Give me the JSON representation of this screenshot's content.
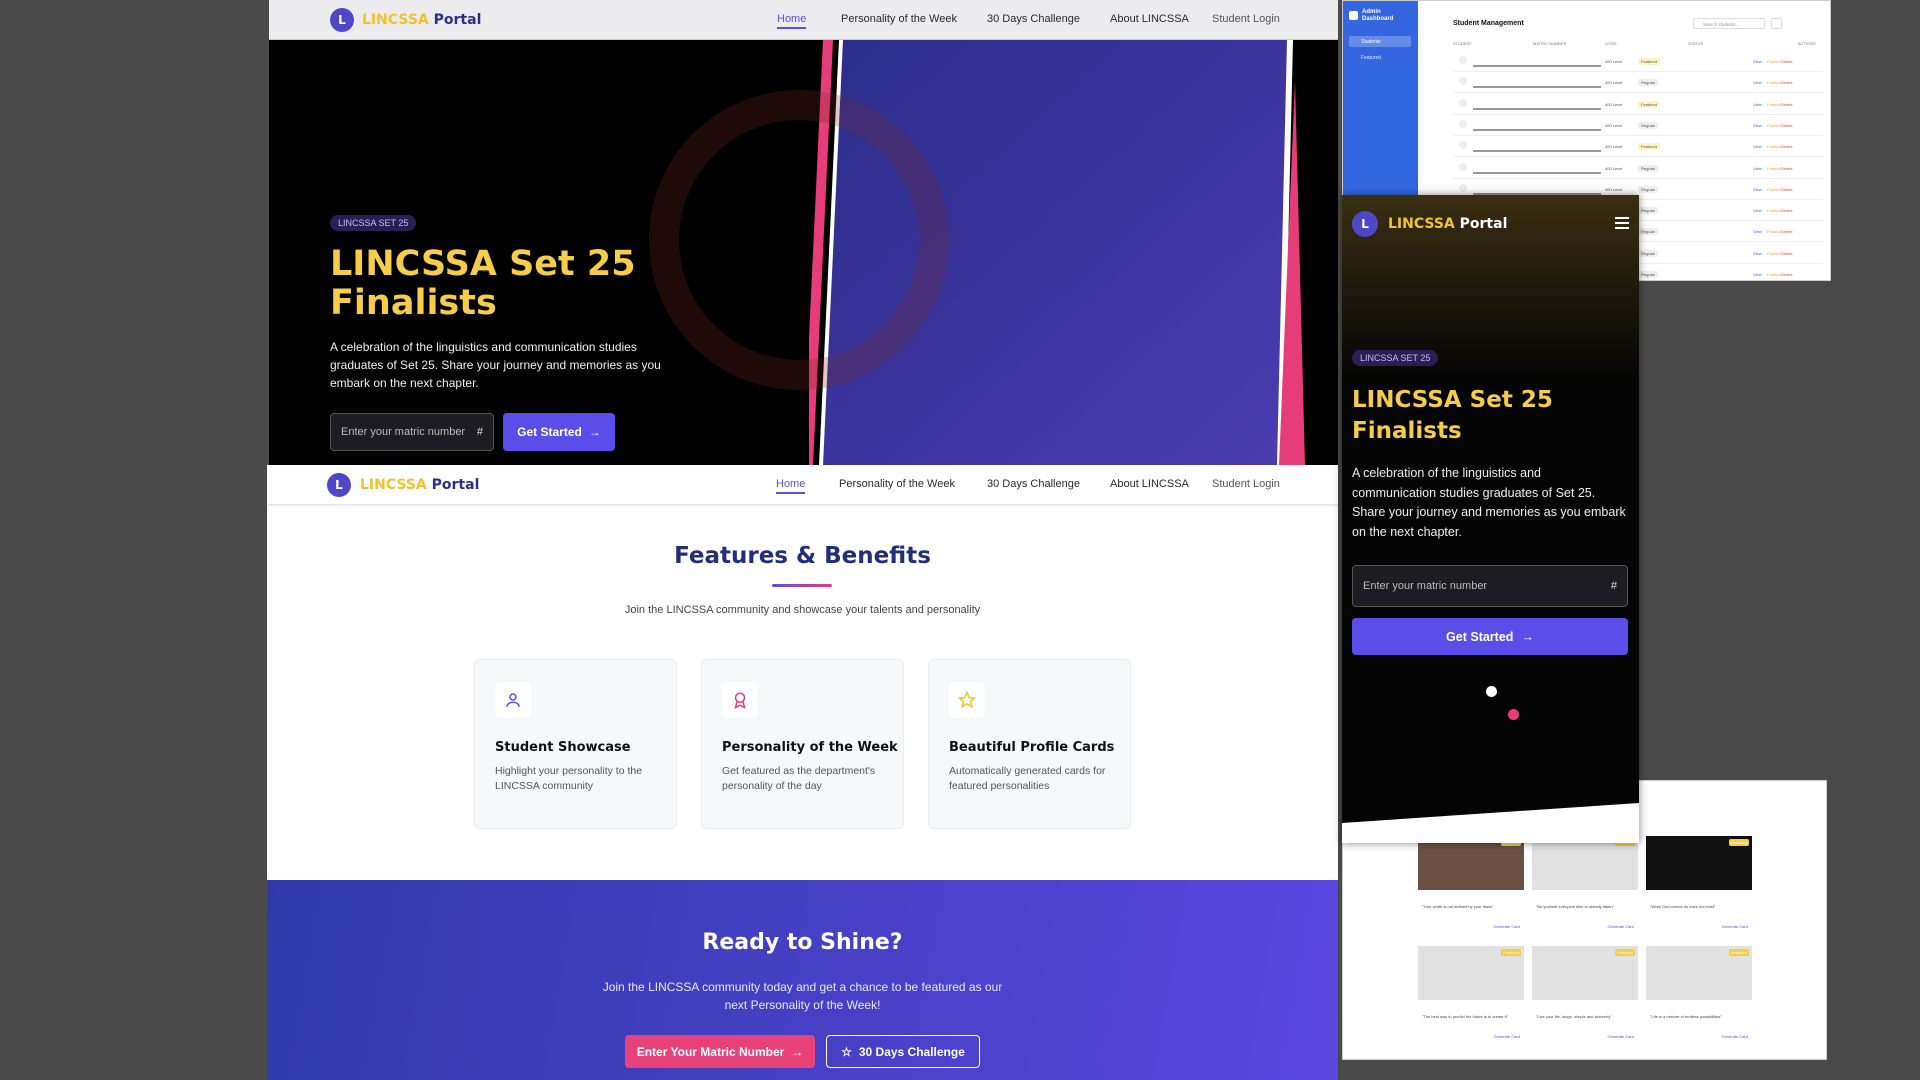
{
  "nav": {
    "logo_letter": "L",
    "brand_a": "LINCSSA",
    "brand_b": "Portal",
    "links": [
      "Home",
      "Personality of the Week",
      "30 Days Challenge",
      "About LINCSSA",
      "Student Login"
    ]
  },
  "hero": {
    "badge": "LINCSSA SET 25",
    "title_line1": "LINCSSA Set 25",
    "title_line2": "Finalists",
    "description": "A celebration of the linguistics and communication studies graduates of Set 25. Share your journey and memories as you embark on the next chapter.",
    "input_placeholder": "Enter your matric number",
    "hash": "#",
    "cta": "Get Started"
  },
  "features": {
    "title": "Features & Benefits",
    "subtitle": "Join the LINCSSA community and showcase your talents and personality",
    "cards": [
      {
        "icon": "user-icon",
        "title": "Student Showcase",
        "desc": "Highlight your personality to the LINCSSA community"
      },
      {
        "icon": "award-icon",
        "title": "Personality of the Week",
        "desc": "Get featured as the department's personality of the day"
      },
      {
        "icon": "star-icon",
        "title": "Beautiful Profile Cards",
        "desc": "Automatically generated cards for featured personalities"
      }
    ]
  },
  "cta": {
    "title": "Ready to Shine?",
    "desc": "Join the LINCSSA community today and get a chance to be featured as our next Personality of the Week!",
    "btn1": "Enter Your Matric Number",
    "btn2": "30 Days Challenge"
  },
  "admin": {
    "sidebar_title": "Admin Dashboard",
    "items": [
      "Students",
      "Featured"
    ],
    "heading": "Student Management",
    "search_placeholder": "Search students...",
    "columns": [
      "STUDENT",
      "MATRIC NUMBER",
      "LEVEL",
      "STATUS",
      "ACTIONS"
    ],
    "level": "400 Level",
    "statuses": [
      "Featured",
      "Regular",
      "Featured",
      "Regular",
      "Featured",
      "Regular",
      "Regular",
      "Regular",
      "Regular",
      "Regular",
      "Regular"
    ],
    "actions": [
      "View",
      "Feature",
      "Delete"
    ]
  },
  "gallery": {
    "quotes": [
      "Your worth is not defined by your flaws",
      "Be yourself everyone else is already taken",
      "What God cannot do does not exist",
      "The best way to predict the future is to create it",
      "Live your life, laugh, simple and sincerely",
      "Life is a mixture of endless possibilities"
    ],
    "generate": "Generate Card",
    "badge": "Featured"
  }
}
